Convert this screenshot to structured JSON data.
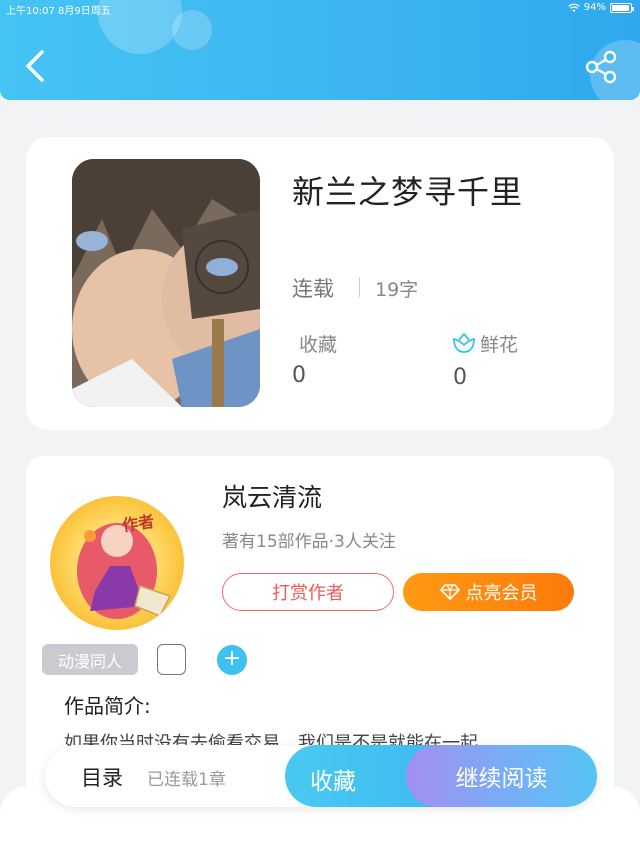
{
  "status_bar": {
    "time": "上午10:07",
    "date": "8月9日周五",
    "battery": "94%"
  },
  "header": {
    "back_icon": "chevron-left-icon",
    "share_icon": "share-icon",
    "accent": "#3db3f0"
  },
  "book": {
    "title": "新兰之梦寻千里",
    "status": "连载",
    "word_count": "19字",
    "favorites_label": "收藏",
    "favorites_value": "0",
    "flowers_label": "鲜花",
    "flowers_value": "0"
  },
  "author": {
    "name": "岚云清流",
    "avatar_tag": "作者",
    "meta": "著有15部作品·3人关注",
    "tip_button": "打赏作者",
    "vip_button": "点亮会员"
  },
  "tags": {
    "items": [
      "动漫同人"
    ],
    "add_label": "+"
  },
  "intro": {
    "heading": "作品简介:",
    "text": "如果你当时没有去偷看交易，我们是不是就能在一起"
  },
  "bottom_bar": {
    "toc_label": "目录",
    "toc_progress": "已连载1章",
    "favorite_button": "收藏",
    "read_button": "继续阅读"
  }
}
